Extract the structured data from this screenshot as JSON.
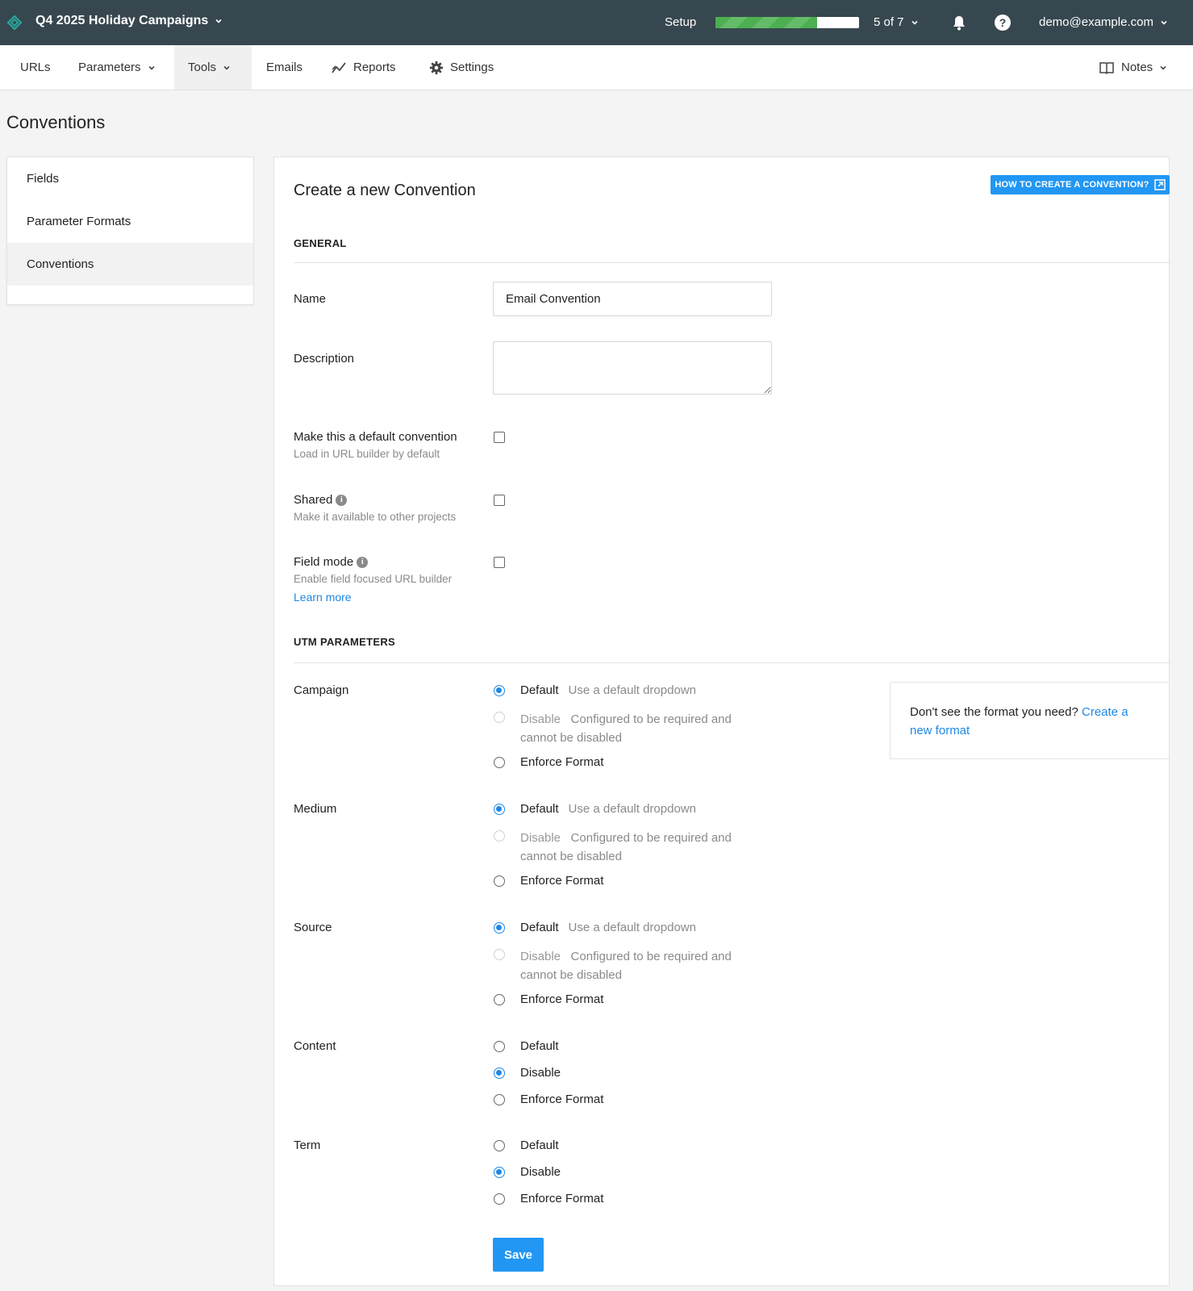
{
  "topbar": {
    "project": "Q4 2025 Holiday Campaigns",
    "setup_label": "Setup",
    "progress": 0.71,
    "steps": "5 of 7",
    "user": "demo@example.com",
    "help_glyph": "?"
  },
  "nav": {
    "items": [
      {
        "label": "URLs"
      },
      {
        "label": "Parameters"
      },
      {
        "label": "Tools"
      },
      {
        "label": "Emails"
      },
      {
        "label": "Reports"
      },
      {
        "label": "Settings"
      }
    ],
    "notes": "Notes"
  },
  "page_title": "Conventions",
  "sidebar": {
    "items": [
      {
        "label": "Fields"
      },
      {
        "label": "Parameter Formats"
      },
      {
        "label": "Conventions"
      }
    ]
  },
  "form": {
    "title": "Create a new Convention",
    "help_button": "HOW TO CREATE A CONVENTION?",
    "general": {
      "section": "GENERAL",
      "name_label": "Name",
      "name_value": "Email Convention",
      "description_label": "Description",
      "description_value": "",
      "default_label": "Make this a default convention",
      "default_sub": "Load in URL builder by default",
      "shared_label": "Shared",
      "shared_sub": "Make it available to other projects",
      "field_mode_label": "Field mode",
      "field_mode_sub": "Enable field focused URL builder",
      "learn_more": "Learn more"
    },
    "utm": {
      "section": "UTM PARAMETERS",
      "default_label": "Default",
      "default_hint": "Use a default dropdown",
      "disable_label": "Disable",
      "disable_hint_1": "Configured to be required and",
      "disable_hint_2": "cannot be disabled",
      "enforce_label": "Enforce Format",
      "params": [
        {
          "name": "Campaign",
          "selected": "Default"
        },
        {
          "name": "Medium",
          "selected": "Default"
        },
        {
          "name": "Source",
          "selected": "Default"
        },
        {
          "name": "Content",
          "selected": "Disable"
        },
        {
          "name": "Term",
          "selected": "Disable"
        }
      ]
    },
    "tip": {
      "text": "Don't see the format you need?",
      "link_1": "Create a",
      "link_2": "new format"
    },
    "save": "Save"
  },
  "colors": {
    "topbar": "#37474f",
    "accent": "#2196f3",
    "link": "#1e88e5",
    "progress": "#4caf50"
  }
}
